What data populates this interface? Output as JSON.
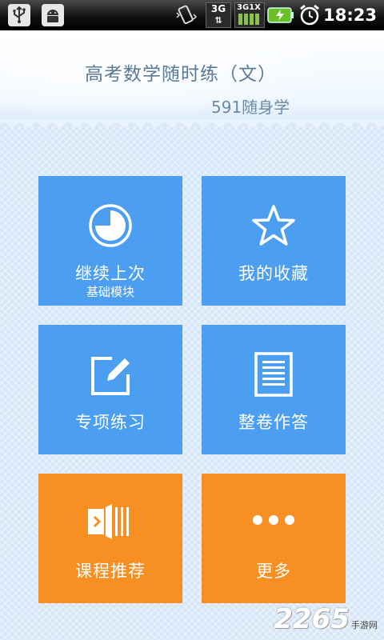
{
  "status_bar": {
    "time": "18:23",
    "icons": [
      "usb-icon",
      "android-debug-icon",
      "vibrate-icon",
      "3g-data-icon",
      "3g1x-signal-icon",
      "battery-charging-icon",
      "alarm-clock-icon"
    ],
    "labels": {
      "three_g": "3G",
      "three_g_1x": "3G1X"
    }
  },
  "header": {
    "title": "高考数学随时练（文）",
    "subtitle": "591随身学"
  },
  "tiles": [
    {
      "label": "继续上次",
      "sublabel": "基础模块",
      "icon": "pie-clock-icon"
    },
    {
      "label": "我的收藏",
      "icon": "star-icon"
    },
    {
      "label": "专项练习",
      "icon": "edit-icon"
    },
    {
      "label": "整卷作答",
      "icon": "document-icon"
    },
    {
      "label": "课程推荐",
      "icon": "course-icon"
    },
    {
      "label": "更多",
      "icon": "more-icon"
    }
  ],
  "colors": {
    "tile_blue": "#4b9ef0",
    "tile_orange": "#f78f22",
    "title": "#5b7a98"
  },
  "watermark": {
    "number": "2265",
    "text": "手游网"
  }
}
